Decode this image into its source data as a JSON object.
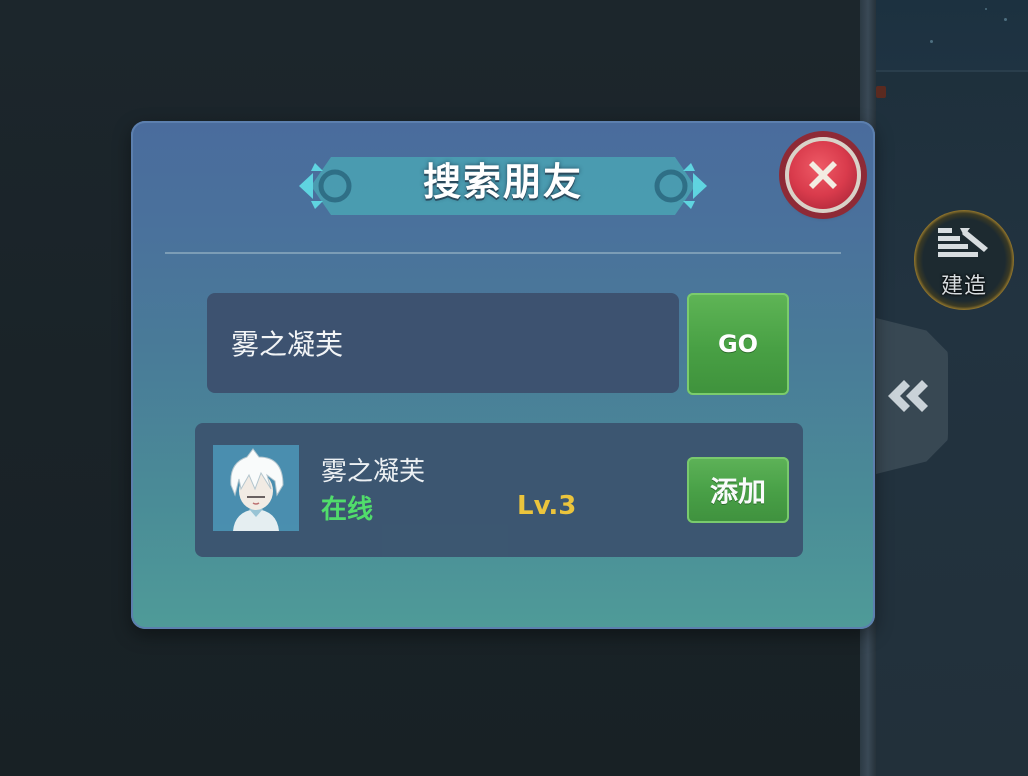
{
  "dialog": {
    "title": "搜索朋友",
    "close_icon": "close-x-icon"
  },
  "search": {
    "value": "雾之凝芙",
    "go_label": "GO"
  },
  "result": {
    "name": "雾之凝芙",
    "status": "在线",
    "level": "Lv.3",
    "add_label": "添加",
    "avatar_icon": "white-haired-character-avatar"
  },
  "side_panel": {
    "build_label": "建造",
    "build_icon": "build-tool-icon",
    "collapse_icon": "double-chevron-left-icon"
  },
  "colors": {
    "status_online": "#52e06a",
    "level": "#f1c63a",
    "button_green": "#48a044",
    "close_red": "#d93b4c",
    "dialog_top": "#4a6c9d",
    "dialog_bottom": "#4f9b98"
  }
}
